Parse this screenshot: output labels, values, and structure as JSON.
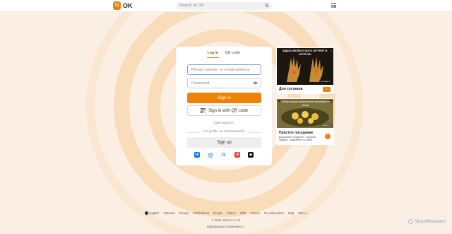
{
  "colors": {
    "accent": "#ee8208",
    "background": "#fbeee3",
    "ring": "#f8d9b4"
  },
  "header": {
    "logo_text": "OK",
    "search_placeholder": "Search on OK",
    "icons": [
      "search-icon",
      "apps-grid-icon"
    ]
  },
  "login": {
    "tabs": [
      {
        "label": "Log in",
        "active": true
      },
      {
        "label": "QR code",
        "active": false
      }
    ],
    "phone_placeholder": "Phone number or email address",
    "password_placeholder": "Password",
    "signin_label": "Sign in",
    "qr_signin_label": "Sign in with QR code",
    "cant_signin": "Can't sign in?",
    "no_profile": "No profile on Odnoklassniki",
    "signup_label": "Sign up",
    "socials": [
      {
        "name": "vk-icon",
        "glyph": "vk"
      },
      {
        "name": "mail-icon",
        "glyph": "@"
      },
      {
        "name": "google-icon",
        "glyph": "G"
      },
      {
        "name": "yandex-icon",
        "glyph": "Я"
      },
      {
        "name": "other-login-icon",
        "glyph": "◆"
      }
    ]
  },
  "ads": [
    {
      "badge": "",
      "caption": "ЕДАТЬ ВСЕМ У КОГО АРТРИТ И АРТРОЗ!",
      "source": "mixolike.ru",
      "title": "Для суставов",
      "subtitle": "",
      "arrow": "›"
    },
    {
      "badge": "",
      "caption": "Сейчас пишем запатентов в сантиметры и таком!",
      "source": "cellulo.cc",
      "title": "Простое похудение",
      "subtitle": "Домашнее похудение - вкусный эффект. Подробнее на сайте",
      "arrow": "›"
    }
  ],
  "footer": {
    "links": [
      "English",
      "Interests",
      "Groups",
      "Publications",
      "People",
      "Videos",
      "Gifts",
      "Games",
      "For advertisers",
      "Help",
      "More ▾"
    ],
    "copyright": "© 2006–2024 LLC VK",
    "info": "Информация о компании ⓘ"
  },
  "watermark": "ScanMalware"
}
